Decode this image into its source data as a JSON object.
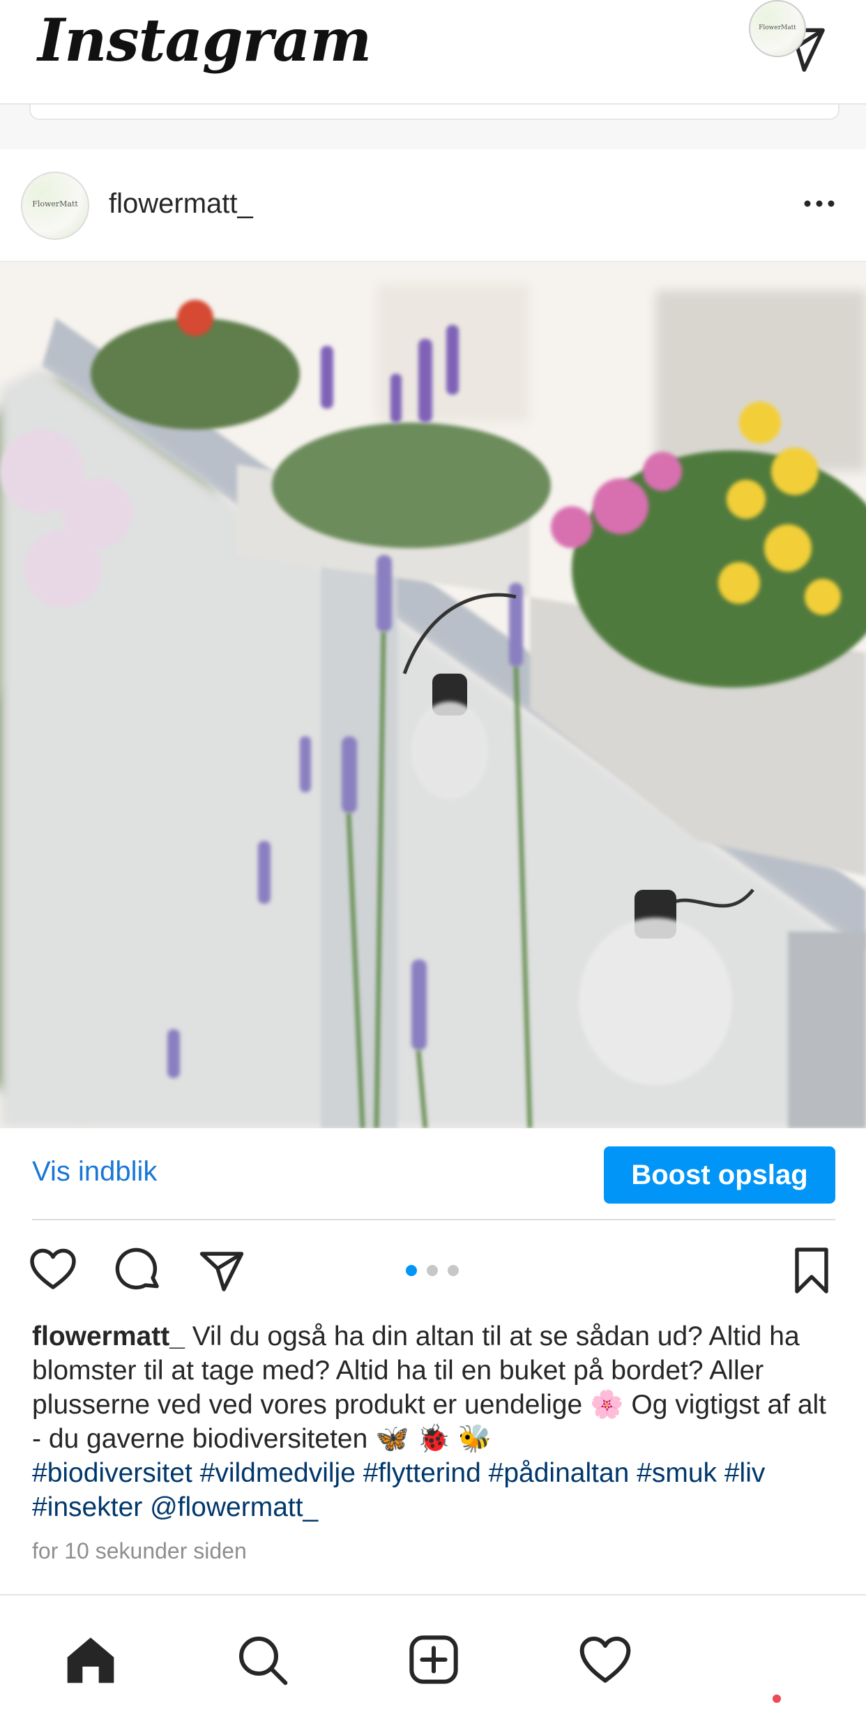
{
  "header": {
    "logo_text": "Instagram",
    "dm_icon": "paper-plane-icon"
  },
  "post": {
    "username": "flowermatt_",
    "avatar_text": "FlowerMatt",
    "more_icon": "more-dots-icon",
    "insights_label": "Vis indblik",
    "boost_label": "Boost opslag",
    "carousel": {
      "count": 3,
      "active": 1
    },
    "caption": {
      "username": "flowermatt_",
      "text": " Vil du også ha din altan til at se sådan ud? Altid ha blomster til at tage med? Altid ha til en buket på bordet? Aller plusserne ved ved vores produkt er uendelige 🌸 Og vigtigst af alt - du gaverne biodiversiteten 🦋 🐞 🐝",
      "tags": "#biodiversitet #vildmedvilje #flytterind #pådinaltan #smuk #liv #insekter @flowermatt_"
    },
    "timestamp": "for 10 sekunder siden"
  },
  "nav": {
    "items": [
      "home-icon",
      "search-icon",
      "add-post-icon",
      "activity-heart-icon",
      "profile-avatar"
    ],
    "profile_avatar_text": "FlowerMatt"
  },
  "colors": {
    "accent": "#0095f6",
    "link": "#1877d6",
    "hashtag": "#00376b",
    "notification": "#ed4956"
  }
}
